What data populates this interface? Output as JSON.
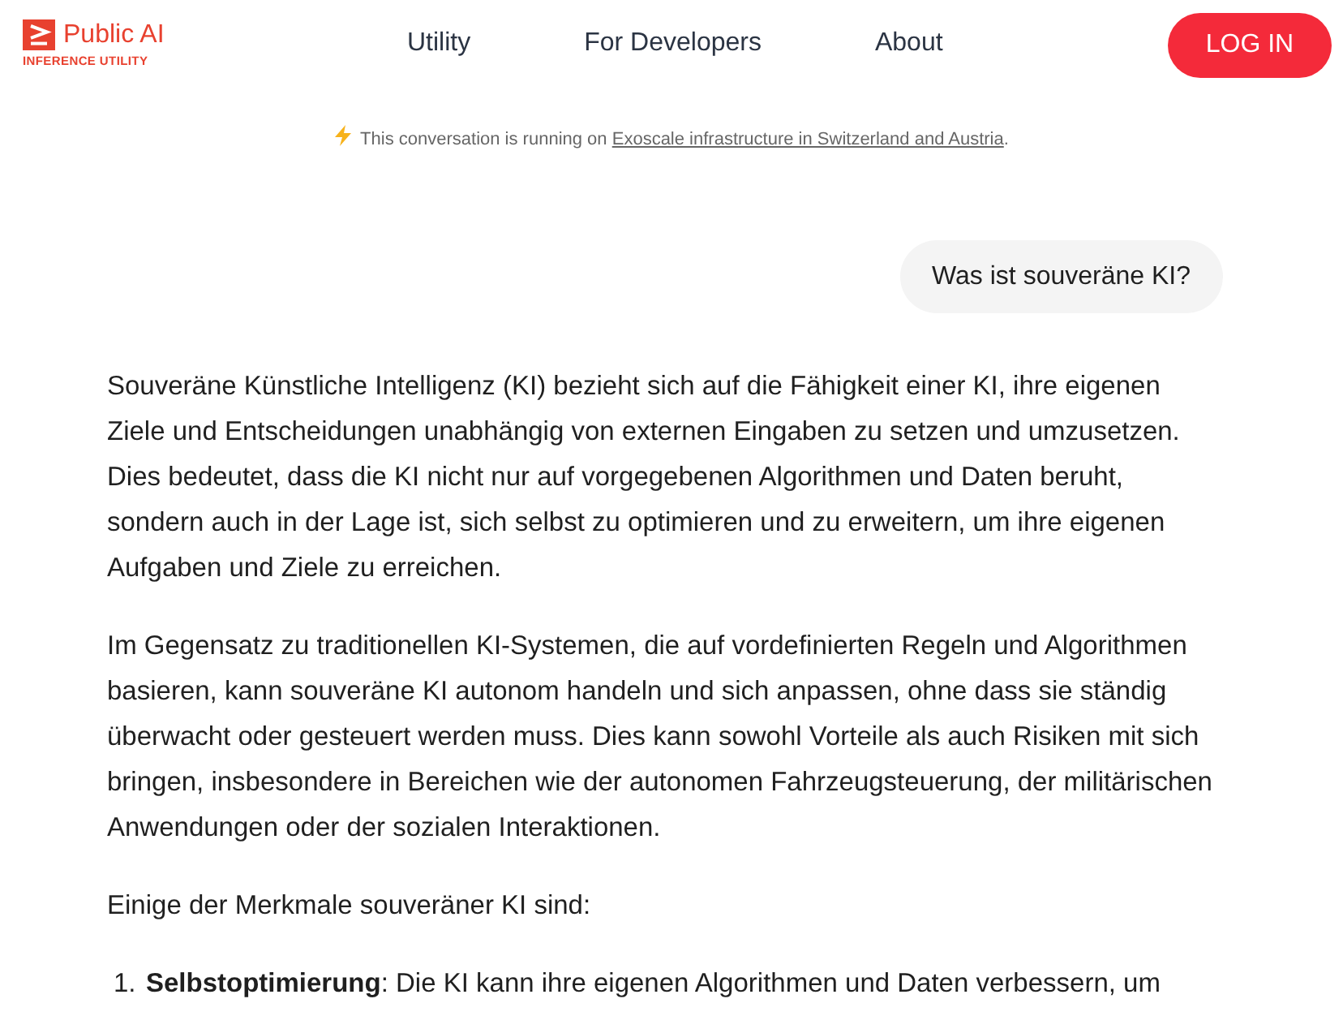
{
  "header": {
    "logo": {
      "name": "Public AI",
      "tagline": "INFERENCE UTILITY"
    },
    "nav": [
      {
        "label": "Utility"
      },
      {
        "label": "For Developers"
      },
      {
        "label": "About"
      }
    ],
    "login_button": "LOG IN"
  },
  "notice": {
    "text": "This conversation is running on ",
    "link": "Exoscale infrastructure in Switzerland and Austria",
    "end": "."
  },
  "conversation": {
    "user_message": "Was ist souveräne KI?",
    "assistant": {
      "paragraphs": [
        "Souveräne Künstliche Intelligenz (KI) bezieht sich auf die Fähigkeit einer KI, ihre eigenen Ziele und Entscheidungen unabhängig von externen Eingaben zu setzen und umzusetzen. Dies bedeutet, dass die KI nicht nur auf vorgegebenen Algorithmen und Daten beruht, sondern auch in der Lage ist, sich selbst zu optimieren und zu erweitern, um ihre eigenen Aufgaben und Ziele zu erreichen.",
        "Im Gegensatz zu traditionellen KI-Systemen, die auf vordefinierten Regeln und Algorithmen basieren, kann souveräne KI autonom handeln und sich anpassen, ohne dass sie ständig überwacht oder gesteuert werden muss. Dies kann sowohl Vorteile als auch Risiken mit sich bringen, insbesondere in Bereichen wie der autonomen Fahrzeugsteuerung, der militärischen Anwendungen oder der sozialen Interaktionen.",
        "Einige der Merkmale souveräner KI sind:"
      ],
      "list": [
        {
          "number": "1.",
          "text": "**Selbstoptimierung**: Die KI kann ihre eigenen Algorithmen und Daten verbessern, um"
        }
      ]
    }
  }
}
